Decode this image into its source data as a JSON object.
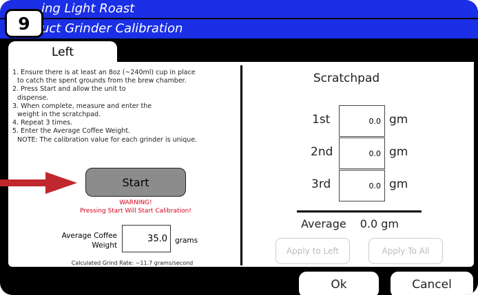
{
  "header": {
    "title_line1": "ing Light Roast",
    "title_line2": "uct Grinder Calibration",
    "step_badge": "9"
  },
  "tabs": [
    {
      "label": "Left",
      "active": true
    }
  ],
  "instructions": [
    "1. Ensure there is at least an 8oz (~240ml) cup in place",
    "to catch the spent grounds from the brew chamber.",
    "2. Press Start and allow the unit to",
    "dispense.",
    "3. When complete, measure and enter the",
    "weight in the scratchpad.",
    "4. Repeat 3 times.",
    "5. Enter the Average Coffee Weight.",
    "NOTE:  The calibration value for each grinder is unique."
  ],
  "start_button": {
    "label": "Start"
  },
  "warning": {
    "line1": "WARNING!",
    "line2": "Pressing Start Will Start Calibration!"
  },
  "average_weight": {
    "label_line1": "Average Coffee",
    "label_line2": "Weight",
    "value": "35.0",
    "unit": "grams"
  },
  "calculated_rate": "Calculated Grind Rate: ~11.7 grams/second",
  "scratchpad": {
    "title": "Scratchpad",
    "rows": [
      {
        "label": "1st",
        "value": "0.0",
        "unit": "gm"
      },
      {
        "label": "2nd",
        "value": "0.0",
        "unit": "gm"
      },
      {
        "label": "3rd",
        "value": "0.0",
        "unit": "gm"
      }
    ],
    "average_label": "Average",
    "average_value": "0.0 gm",
    "apply_left": "Apply to Left",
    "apply_all": "Apply To All"
  },
  "footer": {
    "ok": "Ok",
    "cancel": "Cancel"
  },
  "colors": {
    "header_blue": "#1a2fe6",
    "warning_red": "#d0021b",
    "arrow_red": "#c0282d",
    "start_gray": "#8c8c8c"
  },
  "icons": {
    "pointer_arrow": "right-arrow-icon"
  }
}
